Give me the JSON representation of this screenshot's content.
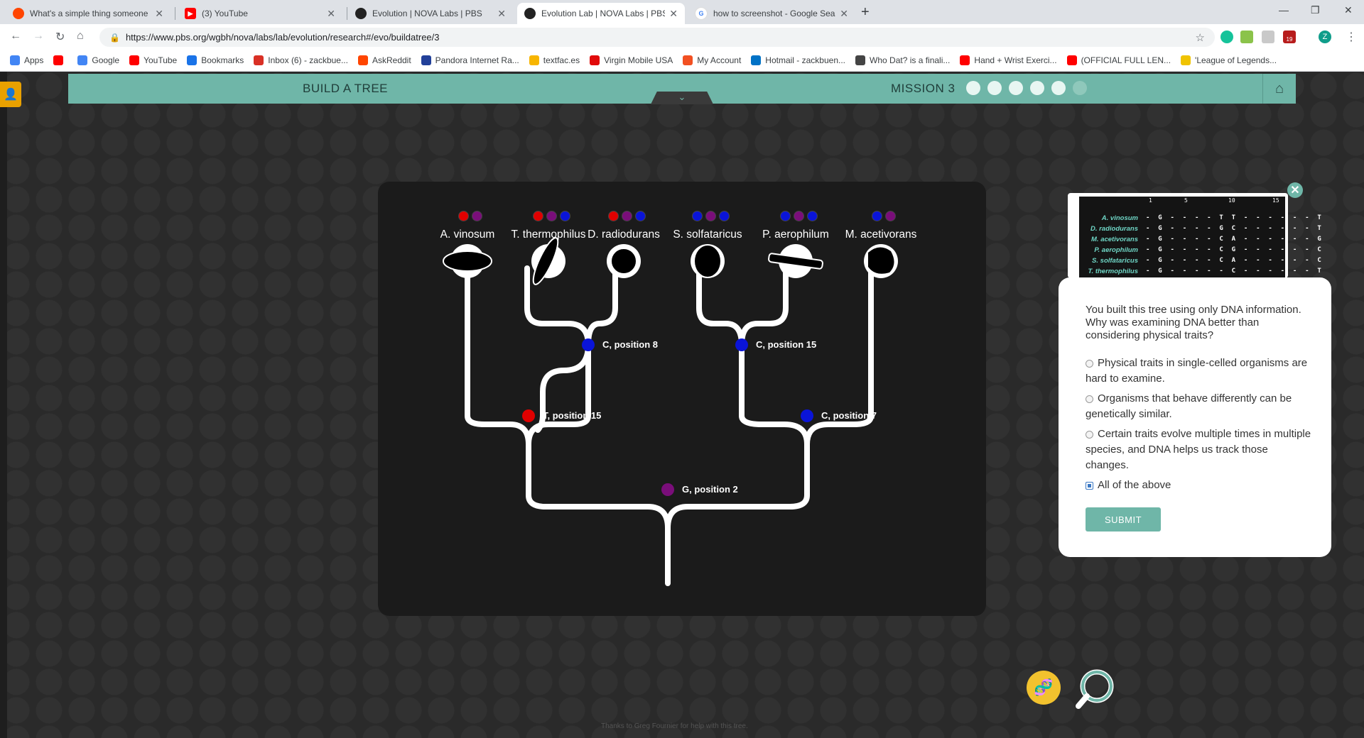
{
  "browser": {
    "tabs": [
      {
        "title": "What's a simple thing someone c",
        "icon": "reddit-icon",
        "color": "#ff4500"
      },
      {
        "title": "(3) YouTube",
        "icon": "youtube-icon",
        "color": "#ff0000"
      },
      {
        "title": "Evolution | NOVA Labs | PBS",
        "icon": "pbs-icon",
        "color": "#222222"
      },
      {
        "title": "Evolution Lab | NOVA Labs | PBS",
        "icon": "pbs-icon",
        "color": "#222222",
        "active": true
      },
      {
        "title": "how to screenshot - Google Sear",
        "icon": "google-icon",
        "color": "#4285f4"
      }
    ],
    "url": "https://www.pbs.org/wgbh/nova/labs/lab/evolution/research#/evo/buildatree/3",
    "bookmarks": [
      {
        "label": "Apps",
        "color": "#4285f4"
      },
      {
        "label": "",
        "color": "#ff0000"
      },
      {
        "label": "Google",
        "color": "#4285f4"
      },
      {
        "label": "YouTube",
        "color": "#ff0000"
      },
      {
        "label": "Bookmarks",
        "color": "#1a73e8"
      },
      {
        "label": "Inbox (6) - zackbue...",
        "color": "#d93025"
      },
      {
        "label": "AskReddit",
        "color": "#ff4500"
      },
      {
        "label": "Pandora Internet Ra...",
        "color": "#224099"
      },
      {
        "label": "textfac.es",
        "color": "#f7b500"
      },
      {
        "label": "Virgin Mobile USA",
        "color": "#e10a0a"
      },
      {
        "label": "My Account",
        "color": "#f25022"
      },
      {
        "label": "Hotmail - zackbuen...",
        "color": "#0072c6"
      },
      {
        "label": "Who Dat? is a finali...",
        "color": "#444444"
      },
      {
        "label": "Hand + Wrist Exerci...",
        "color": "#ff0000"
      },
      {
        "label": "(OFFICIAL FULL LEN...",
        "color": "#ff0000"
      },
      {
        "label": "'League of Legends...",
        "color": "#f0c300"
      }
    ],
    "ext_badge": "19",
    "profile_letter": "Z"
  },
  "app": {
    "title": "BUILD A TREE",
    "mission": "MISSION 3",
    "mission_leaves_total": 6,
    "mission_leaves_done": 5,
    "credit": "Thanks to Greg Fournier for help with this tree."
  },
  "tree": {
    "species": [
      {
        "name": "A. vinosum",
        "dots": [
          "#e00000",
          "#7a0e7a"
        ]
      },
      {
        "name": "T. thermophilus",
        "dots": [
          "#e00000",
          "#7a0e7a",
          "#0a14d8"
        ]
      },
      {
        "name": "D. radiodurans",
        "dots": [
          "#e00000",
          "#7a0e7a",
          "#0a14d8"
        ]
      },
      {
        "name": "S. solfataricus",
        "dots": [
          "#0a14d8",
          "#7a0e7a",
          "#0a14d8"
        ]
      },
      {
        "name": "P. aerophilum",
        "dots": [
          "#0a14d8",
          "#7a0e7a",
          "#0a14d8"
        ]
      },
      {
        "name": "M. acetivorans",
        "dots": [
          "#0a14d8",
          "#7a0e7a"
        ]
      }
    ],
    "nodes": [
      {
        "label": "C, position 8",
        "color": "#0a14d8"
      },
      {
        "label": "C, position 15",
        "color": "#0a14d8"
      },
      {
        "label": "T, position 15",
        "color": "#e00000"
      },
      {
        "label": "C, position 7",
        "color": "#0a14d8"
      },
      {
        "label": "G, position 2",
        "color": "#7a0e7a"
      }
    ]
  },
  "alignment": {
    "ticks": [
      "1",
      "5",
      "10",
      "15"
    ],
    "rows": [
      {
        "name": "A. vinosum",
        "seq": "- G - - - - T T - - - - - - T"
      },
      {
        "name": "D. radiodurans",
        "seq": "- G - - - - G C - - - - - - T"
      },
      {
        "name": "M. acetivorans",
        "seq": "- G - - - - C A - - - - - - G"
      },
      {
        "name": "P. aerophilum",
        "seq": "- G - - - - C G - - - - - - C"
      },
      {
        "name": "S. solfataricus",
        "seq": "- G - - - - C A - - - - - - C"
      },
      {
        "name": "T. thermophilus",
        "seq": "- G - - - - - C - - - - - - T"
      }
    ]
  },
  "question": {
    "text": "You built this tree using only DNA information. Why was examining DNA better than considering physical traits?",
    "options": [
      "Physical traits in single-celled organisms are hard to examine.",
      "Organisms that behave differently can be genetically similar.",
      "Certain traits evolve multiple times in multiple species, and DNA helps us track those changes.",
      "All of the above"
    ],
    "selected_index": 3,
    "submit_label": "SUBMIT"
  },
  "colors": {
    "accent": "#6fb6a8",
    "red": "#e00000",
    "blue": "#0a14d8",
    "purple": "#7a0e7a"
  }
}
